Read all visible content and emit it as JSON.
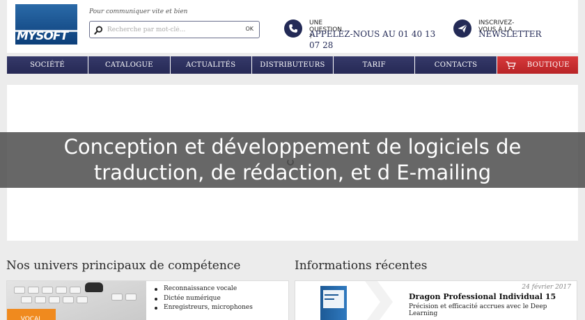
{
  "header": {
    "logo_text": "MYSOFT",
    "tagline": "Pour communiquer vite et bien",
    "search": {
      "placeholder": "Recherche par mot-clé...",
      "button": "OK"
    },
    "question": {
      "title": "UNE QUESTION ?",
      "value": "APPELEZ-NOUS AU 01 40 13 07 28",
      "icon": "phone-icon"
    },
    "newsletter": {
      "title": "INSCRIVEZ-VOUS À LA",
      "value": "NEWSLETTER",
      "icon": "send-icon"
    }
  },
  "nav": {
    "items": [
      "SOCIÉTÉ",
      "CATALOGUE",
      "ACTUALITÉS",
      "DISTRIBUTEURS",
      "TARIF",
      "CONTACTS"
    ],
    "shop": "BOUTIQUE",
    "shop_color": "#c92d2f",
    "bar_color": "#2b2e5c"
  },
  "banner": {
    "text": "Conception et développement de logiciels de traduction, de rédaction, et d E-mailing"
  },
  "sections": {
    "left_title": "Nos univers principaux de compétence",
    "right_title": "Informations récentes"
  },
  "universes": {
    "tag": "VOCAL",
    "tag_color": "#f08a1e",
    "bullets": [
      "Reconnaissance vocale",
      "Dictée numérique",
      "Enregistreurs, microphones"
    ]
  },
  "news": {
    "date": "24 février 2017",
    "title": "Dragon Professional Individual 15",
    "subtitle": "Précision et efficacité accrues avec le Deep Learning"
  }
}
